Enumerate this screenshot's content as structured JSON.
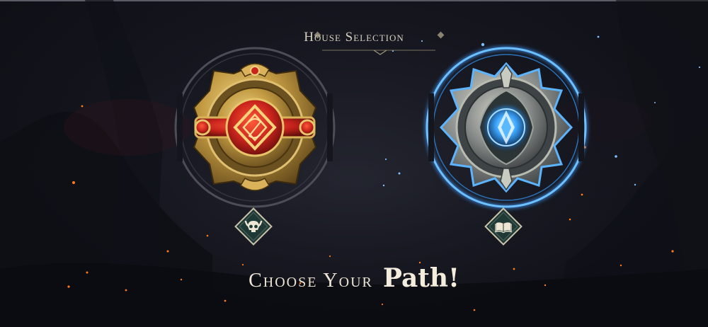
{
  "header": {
    "title": "House Selection"
  },
  "houses": [
    {
      "name": "fire-house-emblem",
      "badge_icon": "horned-skull-icon"
    },
    {
      "name": "mind-house-emblem",
      "badge_icon": "open-book-icon"
    }
  ],
  "cta": {
    "lead": "Choose Your",
    "accent": "Path!"
  },
  "colors": {
    "fire_accent": "#c8241c",
    "gold": "#c9a44a",
    "mind_accent": "#3ea8ff",
    "steel": "#8a8e8c",
    "badge_green": "#1f3a36",
    "text": "#ece4d4"
  }
}
